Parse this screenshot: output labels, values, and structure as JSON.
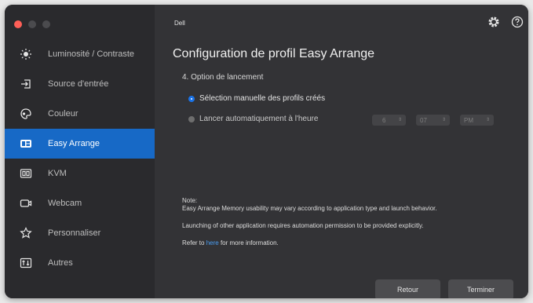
{
  "header": {
    "app_title": "Dell"
  },
  "sidebar": {
    "items": [
      {
        "label": "Luminosité / Contraste",
        "icon": "brightness-icon"
      },
      {
        "label": "Source d'entrée",
        "icon": "input-source-icon"
      },
      {
        "label": "Couleur",
        "icon": "color-icon"
      },
      {
        "label": "Easy Arrange",
        "icon": "easy-arrange-icon",
        "active": true
      },
      {
        "label": "KVM",
        "icon": "kvm-icon"
      },
      {
        "label": "Webcam",
        "icon": "webcam-icon"
      },
      {
        "label": "Personnaliser",
        "icon": "star-icon"
      },
      {
        "label": "Autres",
        "icon": "others-icon"
      }
    ]
  },
  "main": {
    "title": "Configuration de profil Easy Arrange",
    "step_title": "4. Option de lancement",
    "option_manual": "Sélection manuelle des profils créés",
    "option_auto": "Lancer automatiquement à l'heure",
    "time": {
      "hour": "6",
      "minute": "07",
      "ampm": "PM"
    },
    "note_heading": "Note:",
    "note_line1": "Easy Arrange Memory usability may vary according to application type and launch behavior.",
    "note_line2": "Launching of other application requires automation permission to be provided explicitly.",
    "refer_prefix": "Refer to",
    "refer_link": "here",
    "refer_suffix": "for more information.",
    "back_label": "Retour",
    "finish_label": "Terminer"
  },
  "colors": {
    "accent": "#1769c6",
    "link": "#4a9cf0",
    "background": "#333336",
    "sidebar": "#2a2a2d"
  }
}
